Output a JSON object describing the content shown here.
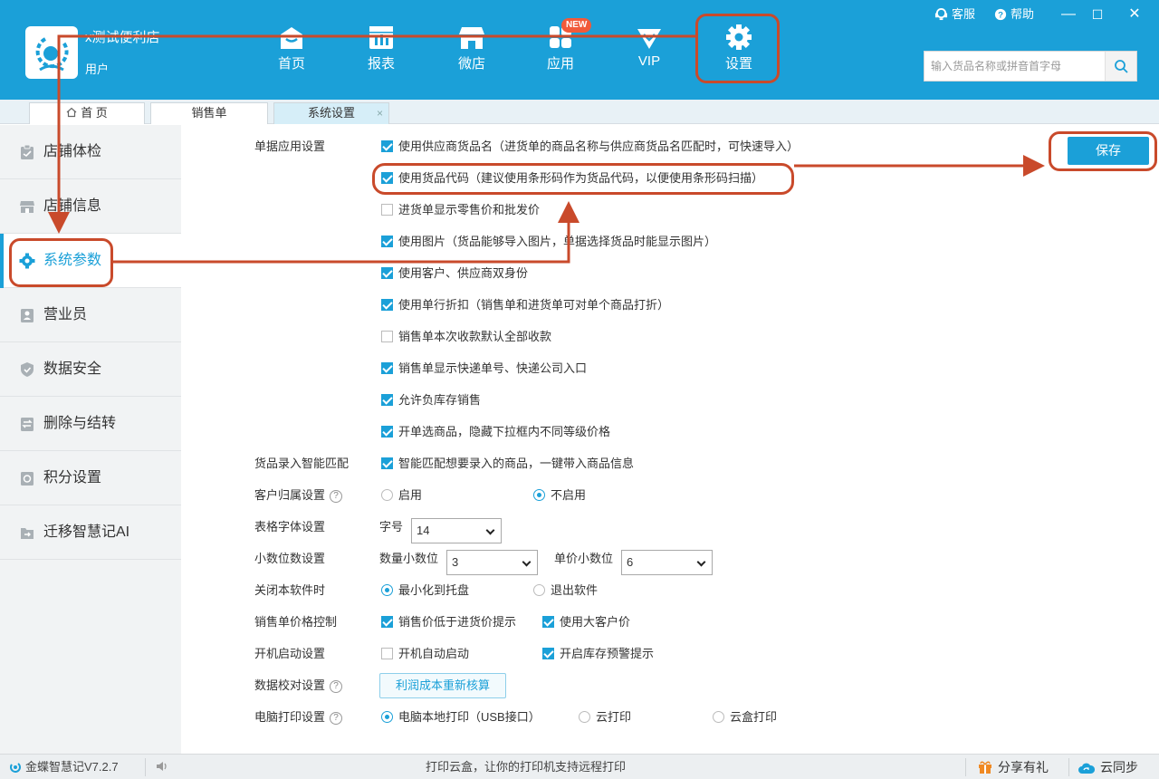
{
  "app": {
    "store_name": "x测试便利店",
    "user_role": "用户"
  },
  "nav": [
    {
      "label": "首页",
      "icon": "home-icon"
    },
    {
      "label": "报表",
      "icon": "report-icon"
    },
    {
      "label": "微店",
      "icon": "shop-icon"
    },
    {
      "label": "应用",
      "icon": "apps-icon",
      "badge": "NEW"
    },
    {
      "label": "VIP",
      "icon": "vip-icon"
    },
    {
      "label": "设置",
      "icon": "gear-icon"
    }
  ],
  "top_links": {
    "service": "客服",
    "help": "帮助"
  },
  "window_controls": {
    "minimize": "—",
    "maximize": "☐",
    "close": "✕"
  },
  "search": {
    "placeholder": "输入货品名称或拼音首字母"
  },
  "tabs": [
    {
      "label": "首 页",
      "icon": "home-icon"
    },
    {
      "label": "销售单"
    },
    {
      "label": "系统设置",
      "active": true,
      "close": "×"
    }
  ],
  "sidebar": {
    "items": [
      {
        "label": "店铺体检",
        "icon": "clipboard-icon"
      },
      {
        "label": "店铺信息",
        "icon": "store-icon"
      },
      {
        "label": "系统参数",
        "icon": "gear-icon",
        "active": true
      },
      {
        "label": "营业员",
        "icon": "staff-icon"
      },
      {
        "label": "数据安全",
        "icon": "shield-icon"
      },
      {
        "label": "删除与结转",
        "icon": "transfer-icon"
      },
      {
        "label": "积分设置",
        "icon": "points-icon"
      },
      {
        "label": "迁移智慧记AI",
        "icon": "migrate-icon"
      }
    ]
  },
  "settings": {
    "save_label": "保存",
    "doc_label": "单据应用设置",
    "doc_options": [
      {
        "label": "使用供应商货品名（进货单的商品名称与供应商货品名匹配时，可快速导入）",
        "checked": true
      },
      {
        "label": "使用货品代码（建议使用条形码作为货品代码，以便使用条形码扫描）",
        "checked": true
      },
      {
        "label": "进货单显示零售价和批发价",
        "checked": false
      },
      {
        "label": "使用图片（货品能够导入图片，单据选择货品时能显示图片）",
        "checked": true
      },
      {
        "label": "使用客户、供应商双身份",
        "checked": true
      },
      {
        "label": "使用单行折扣（销售单和进货单可对单个商品打折）",
        "checked": true
      },
      {
        "label": "销售单本次收款默认全部收款",
        "checked": false
      },
      {
        "label": "销售单显示快递单号、快递公司入口",
        "checked": true
      },
      {
        "label": "允许负库存销售",
        "checked": true
      },
      {
        "label": "开单选商品，隐藏下拉框内不同等级价格",
        "checked": true
      }
    ],
    "smart_match": {
      "label": "货品录入智能匹配",
      "option": "智能匹配想要录入的商品，一键带入商品信息",
      "checked": true
    },
    "customer_owner": {
      "label": "客户归属设置",
      "help": "?",
      "options": [
        {
          "label": "启用",
          "selected": false
        },
        {
          "label": "不启用",
          "selected": true
        }
      ]
    },
    "font": {
      "label": "表格字体设置",
      "size_label": "字号",
      "size_value": "14"
    },
    "decimals": {
      "label": "小数位数设置",
      "qty_label": "数量小数位",
      "qty_value": "3",
      "price_label": "单价小数位",
      "price_value": "6"
    },
    "close_app": {
      "label": "关闭本软件时",
      "options": [
        {
          "label": "最小化到托盘",
          "selected": true
        },
        {
          "label": "退出软件",
          "selected": false
        }
      ]
    },
    "price_control": {
      "label": "销售单价格控制",
      "options": [
        {
          "label": "销售价低于进货价提示",
          "checked": true
        },
        {
          "label": "使用大客户价",
          "checked": true
        }
      ]
    },
    "startup": {
      "label": "开机启动设置",
      "options": [
        {
          "label": "开机自动启动",
          "checked": false
        },
        {
          "label": "开启库存预警提示",
          "checked": true
        }
      ]
    },
    "data_check": {
      "label": "数据校对设置",
      "help": "?",
      "button": "利润成本重新核算"
    },
    "print": {
      "label": "电脑打印设置",
      "help": "?",
      "options": [
        {
          "label": "电脑本地打印（USB接口）",
          "selected": true
        },
        {
          "label": "云打印",
          "selected": false
        },
        {
          "label": "云盒打印",
          "selected": false
        }
      ]
    }
  },
  "status": {
    "version": "金蝶智慧记V7.2.7",
    "message": "打印云盒，让你的打印机支持远程打印",
    "share": "分享有礼",
    "sync": "云同步"
  },
  "colors": {
    "primary": "#1ba0d8",
    "annotation": "#c94a2b",
    "sidebar_bg": "#f1f3f4"
  }
}
